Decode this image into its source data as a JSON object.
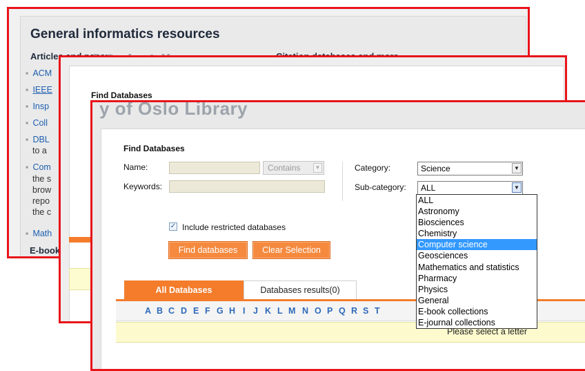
{
  "window1": {
    "title": "General informatics resources",
    "section_left": "Articles and papers",
    "section_right": "Citation databases and more",
    "ghost_text": "y of Oslo Library",
    "links": [
      {
        "text": "ACM"
      },
      {
        "text": "IEEE"
      },
      {
        "text": "Insp"
      },
      {
        "text": "Coll"
      },
      {
        "text": "DBL",
        "extra": "to a"
      },
      {
        "text": "Com",
        "extra": "the s brow repo the c"
      },
      {
        "text": "Math"
      }
    ],
    "ebook_heading": "E-book"
  },
  "window2": {
    "ghost_text": "y of Oslo Library",
    "find_label": "Find Databases"
  },
  "window3": {
    "ghost_text": "y of Oslo Library",
    "find_label": "Find Databases",
    "name_label": "Name:",
    "keywords_label": "Keywords:",
    "contains_value": "Contains",
    "category_label": "Category:",
    "category_value": "Science",
    "subcategory_label": "Sub-category:",
    "subcategory_value": "ALL",
    "include_restricted_label": "Include restricted databases",
    "include_restricted_checked": true,
    "find_button": "Find databases",
    "clear_button": "Clear Selection",
    "tab_all": "All Databases",
    "tab_results": "Databases results(0)",
    "letters": [
      "A",
      "B",
      "C",
      "D",
      "E",
      "F",
      "G",
      "H",
      "I",
      "J",
      "K",
      "L",
      "M",
      "N",
      "O",
      "P",
      "Q",
      "R",
      "S",
      "T"
    ],
    "select_letter_msg": "Please select a letter"
  },
  "subcategory_options": [
    "ALL",
    "Astronomy",
    "Biosciences",
    "Chemistry",
    "Computer science",
    "Geosciences",
    "Mathematics and statistics",
    "Pharmacy",
    "Physics",
    "General",
    "E-book collections",
    "E-journal collections"
  ],
  "subcategory_highlighted": "Computer science",
  "colors": {
    "frame_red": "#e8141a",
    "accent_orange": "#f47c2b",
    "link_blue": "#1d5fb0",
    "highlight_blue": "#3399ff"
  }
}
